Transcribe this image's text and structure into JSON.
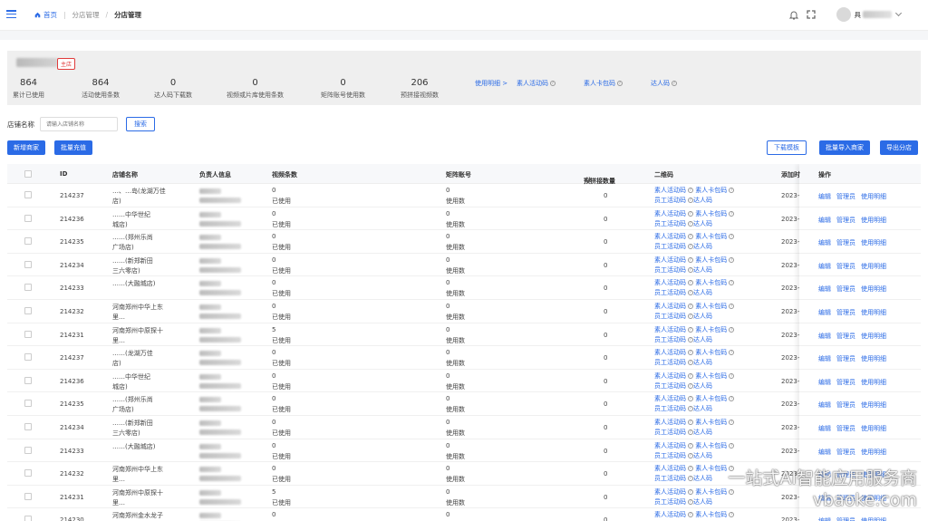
{
  "breadcrumb": {
    "home": "首页",
    "level1": "分店管理",
    "current": "分店管理"
  },
  "header": {
    "user_suffix": "具"
  },
  "stats": {
    "main_tag": "主店",
    "items": [
      {
        "value": "864",
        "label": "累计已使用"
      },
      {
        "value": "864",
        "label": "活动使用条数"
      },
      {
        "value": "0",
        "label": "达人码下载数"
      },
      {
        "value": "0",
        "label": "视频或片库使用条数"
      },
      {
        "value": "0",
        "label": "矩阵账号使用数"
      },
      {
        "value": "206",
        "label": "预拼接视频数"
      }
    ],
    "links": [
      "使用明细 >",
      "素人活动码",
      "素人卡包码",
      "达人码"
    ]
  },
  "search": {
    "label": "店铺名称",
    "placeholder": "请输入店铺名称",
    "button": "搜索"
  },
  "toolbar": {
    "add_merchant": "新增商家",
    "batch_recharge": "批量充值",
    "download_template": "下载模板",
    "batch_import": "批量导入商家",
    "export_branch": "导出分店"
  },
  "table": {
    "headers": {
      "id": "ID",
      "shop_name": "店铺名称",
      "owner": "负责人信息",
      "video_count": "视频条数",
      "matrix": "矩阵账号",
      "splice": "预拼接数量",
      "qrcode": "二维码",
      "added": "添加时",
      "ops": "操作"
    },
    "qr_labels": {
      "a": "素人活动码",
      "b": "素人卡包码",
      "c": "员工活动码",
      "d": "达人码"
    },
    "ops_labels": {
      "edit": "编辑",
      "admin": "管理员",
      "detail": "使用明细"
    },
    "used_label": "已使用",
    "matrix_label": "使用数",
    "rows": [
      {
        "id": "214237",
        "name1": "…、…岛(龙湖万佳",
        "name2": "店)",
        "video": "0",
        "matrix": "0",
        "splice": "0",
        "date": "2023-"
      },
      {
        "id": "214236",
        "name1": "……中华世纪",
        "name2": "城店)",
        "video": "0",
        "matrix": "0",
        "splice": "0",
        "date": "2023-"
      },
      {
        "id": "214235",
        "name1": "……(郑州乐尚",
        "name2": "广场店)",
        "video": "0",
        "matrix": "0",
        "splice": "0",
        "date": "2023-"
      },
      {
        "id": "214234",
        "name1": "……(新郑新田",
        "name2": "三六零店)",
        "video": "0",
        "matrix": "0",
        "splice": "0",
        "date": "2023-"
      },
      {
        "id": "214233",
        "name1": "……(大融城店)",
        "name2": "",
        "video": "0",
        "matrix": "0",
        "splice": "0",
        "date": "2023-"
      },
      {
        "id": "214232",
        "name1": "河南郑州中华上东",
        "name2": "里…",
        "video": "0",
        "matrix": "0",
        "splice": "0",
        "date": "2023-"
      },
      {
        "id": "214231",
        "name1": "河南郑州中原探十",
        "name2": "里…",
        "video": "5",
        "matrix": "0",
        "splice": "0",
        "date": "2023-"
      },
      {
        "id": "214237",
        "name1": "……(龙湖万佳",
        "name2": "店)",
        "video": "0",
        "matrix": "0",
        "splice": "0",
        "date": "2023-"
      },
      {
        "id": "214236",
        "name1": "……中华世纪",
        "name2": "城店)",
        "video": "0",
        "matrix": "0",
        "splice": "0",
        "date": "2023-"
      },
      {
        "id": "214235",
        "name1": "……(郑州乐尚",
        "name2": "广场店)",
        "video": "0",
        "matrix": "0",
        "splice": "0",
        "date": "2023-"
      },
      {
        "id": "214234",
        "name1": "……(新郑新田",
        "name2": "三六零店)",
        "video": "0",
        "matrix": "0",
        "splice": "0",
        "date": "2023-"
      },
      {
        "id": "214233",
        "name1": "……(大融城店)",
        "name2": "",
        "video": "0",
        "matrix": "0",
        "splice": "0",
        "date": "2023-"
      },
      {
        "id": "214232",
        "name1": "河南郑州中华上东",
        "name2": "里…",
        "video": "0",
        "matrix": "0",
        "splice": "0",
        "date": "2023-"
      },
      {
        "id": "214231",
        "name1": "河南郑州中原探十",
        "name2": "里…",
        "video": "5",
        "matrix": "0",
        "splice": "0",
        "date": "2023-"
      },
      {
        "id": "214230",
        "name1": "河南郑州金水龙子",
        "name2": "",
        "video": "0",
        "matrix": "0",
        "splice": "0",
        "date": "2023-"
      }
    ]
  },
  "watermark": {
    "line1": "一站式AI智能应用服务商",
    "line2": "vbaoke.com"
  }
}
